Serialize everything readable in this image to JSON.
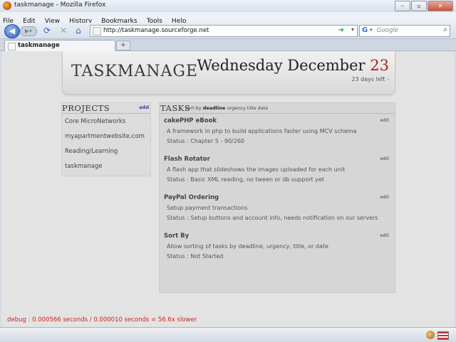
{
  "window": {
    "title": "taskmanage - Mozilla Firefox"
  },
  "menu": [
    "File",
    "Edit",
    "View",
    "History",
    "Bookmarks",
    "Tools",
    "Help"
  ],
  "nav": {
    "url": "http://taskmanage.sourceforge.net",
    "search_placeholder": "Google"
  },
  "tab": {
    "label": "taskmanage"
  },
  "page": {
    "logo": "TASKMANAGE",
    "date_text": "Wednesday December",
    "date_day": "23",
    "days_left": "23 days left -",
    "projects_title": "PROJECTS",
    "projects_add": "add",
    "projects": [
      "Core MicroNetworks",
      "myapartmentwebsite.com",
      "Reading/Learning",
      "taskmanage"
    ],
    "tasks_title": "TASKS",
    "sort_prefix": "sort by",
    "sort_options": [
      "deadline",
      "urgency",
      "title",
      "date"
    ],
    "tasks": [
      {
        "name": "cakePHP eBook",
        "desc": "A framework in php to build applications faster using MCV schema",
        "status": "Status : Chapter 5 - 90/260",
        "edit": "edit"
      },
      {
        "name": "Flash Rotator",
        "desc": "A flash app that slideshows the images uploaded for each unit",
        "status": "Status : Basic XML reading, no tween or db support yet",
        "edit": "edit"
      },
      {
        "name": "PayPal Ordering",
        "desc": "Setup payment transactions",
        "status": "Status : Setup buttons and account info, needs notification on our servers",
        "edit": "edit"
      },
      {
        "name": "Sort By",
        "desc": "Allow sorting of tasks by deadline, urgency, title, or date",
        "status": "Status : Not Started",
        "edit": "edit"
      }
    ],
    "debug": "debug : 0.000566 seconds / 0.000010 seconds = 56.6x slower"
  }
}
